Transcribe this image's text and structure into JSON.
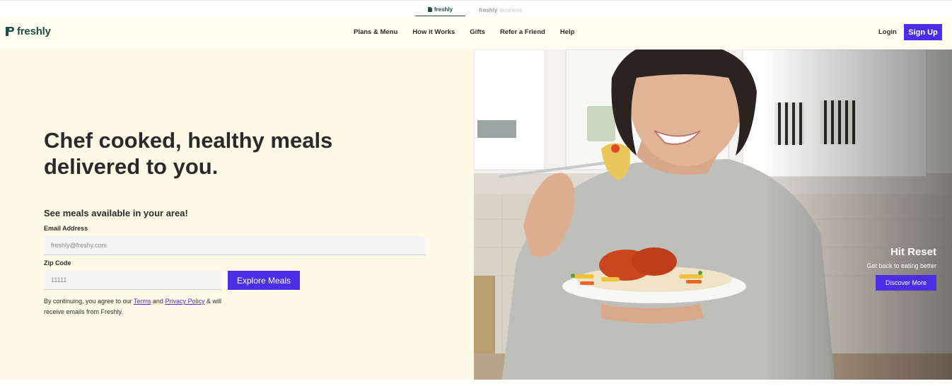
{
  "brand_switcher": {
    "active_label": "freshly",
    "inactive_label": "freshly",
    "inactive_suffix": "business"
  },
  "header": {
    "logo_text": "freshly",
    "nav": [
      "Plans & Menu",
      "How it Works",
      "Gifts",
      "Refer a Friend",
      "Help"
    ],
    "login_label": "Login",
    "signup_label": "Sign Up"
  },
  "hero": {
    "headline": "Chef cooked, healthy meals delivered to you.",
    "subhead": "See meals available in your area!",
    "email_label": "Email Address",
    "email_placeholder": "freshly@freshy.com",
    "zip_label": "Zip Code",
    "zip_placeholder": "11111",
    "cta_label": "Explore Meals",
    "legal": {
      "prefix": "By continuing, you agree to our ",
      "terms": "Terms",
      "and": " and ",
      "privacy": "Privacy Policy",
      "suffix": " & will receive emails from Freshly."
    }
  },
  "promo": {
    "title": "Hit Reset",
    "text": "Get back to eating better",
    "button_label": "Discover More"
  },
  "colors": {
    "brand_green": "#1d4d43",
    "accent_purple": "#4c2ee8",
    "hero_bg": "#fff9e7"
  }
}
